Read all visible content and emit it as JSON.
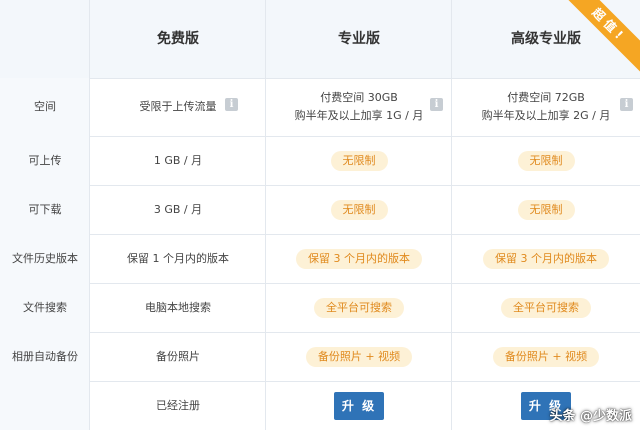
{
  "header": {
    "plan_free": "免费版",
    "plan_pro": "专业版",
    "plan_premium": "高级专业版",
    "ribbon": "超值!"
  },
  "rows": [
    {
      "label": "空间",
      "free": "受限于上传流量",
      "pro_line1": "付费空间 30GB",
      "pro_line2": "购半年及以上加享 1G / 月",
      "premium_line1": "付费空间 72GB",
      "premium_line2": "购半年及以上加享 2G / 月"
    },
    {
      "label": "可上传",
      "free": "1 GB / 月",
      "pro": "无限制",
      "premium": "无限制"
    },
    {
      "label": "可下载",
      "free": "3 GB / 月",
      "pro": "无限制",
      "premium": "无限制"
    },
    {
      "label": "文件历史版本",
      "free": "保留 1 个月内的版本",
      "pro": "保留 3 个月内的版本",
      "premium": "保留 3 个月内的版本"
    },
    {
      "label": "文件搜索",
      "free": "电脑本地搜索",
      "pro": "全平台可搜索",
      "premium": "全平台可搜索"
    },
    {
      "label": "相册自动备份",
      "free": "备份照片",
      "pro": "备份照片 + 视频",
      "premium": "备份照片 + 视频"
    }
  ],
  "footer": {
    "free_status": "已经注册",
    "pro_button": "升 级",
    "premium_button": "升 级"
  },
  "info_glyph": "i",
  "watermark": "头条 @少数派",
  "colors": {
    "accent": "#2f73b7",
    "pill_bg": "#fdf1d6",
    "pill_text": "#e08a1e",
    "ribbon": "#f5a623",
    "header_bg": "#f3f7fb"
  }
}
